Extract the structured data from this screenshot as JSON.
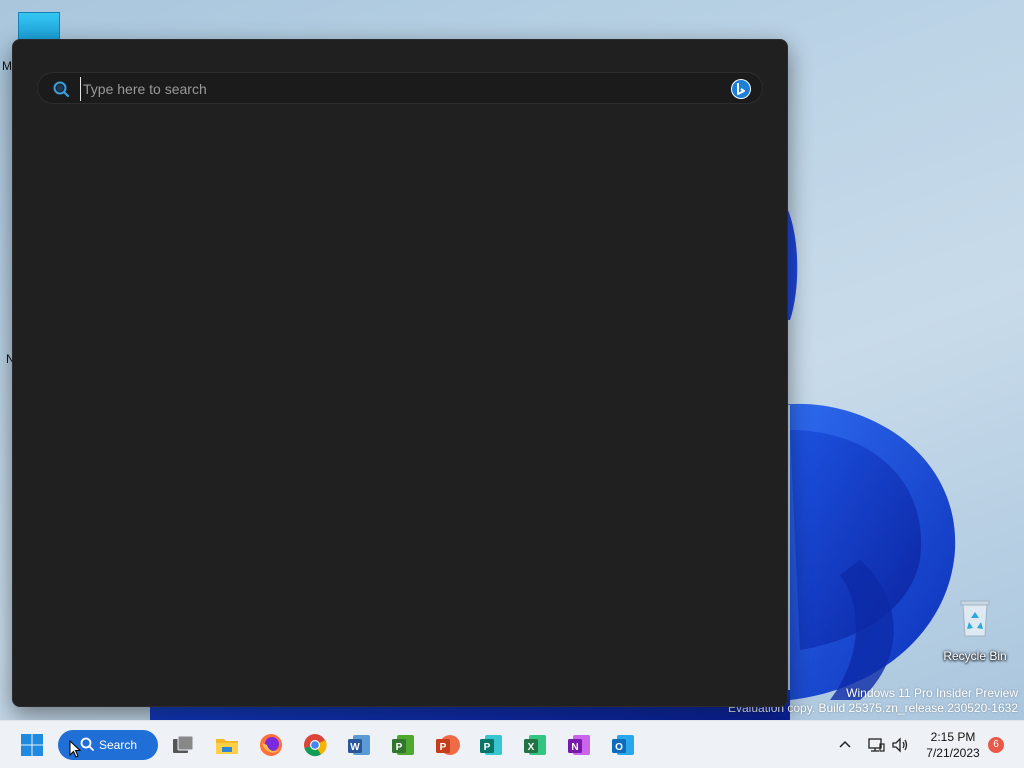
{
  "desktop": {
    "side_letters": [
      "M",
      "N"
    ],
    "recycle_bin_label": "Recycle Bin",
    "watermark_line1": "Windows 11 Pro Insider Preview",
    "watermark_line2": "Evaluation copy. Build 25375.zn_release.230520-1632"
  },
  "search_panel": {
    "placeholder": "Type here to search",
    "value": "",
    "left_icon": "search-icon",
    "right_icon": "bing-chat-icon"
  },
  "taskbar": {
    "start_icon": "windows-start-icon",
    "search_label": "Search",
    "apps": [
      {
        "name": "task-view-icon"
      },
      {
        "name": "file-explorer-icon"
      },
      {
        "name": "firefox-icon"
      },
      {
        "name": "chrome-icon"
      },
      {
        "name": "word-icon",
        "letter": "W",
        "color": "#2b579a"
      },
      {
        "name": "project-icon",
        "letter": "P",
        "color": "#31752f"
      },
      {
        "name": "powerpoint-icon",
        "letter": "P",
        "color": "#d24726"
      },
      {
        "name": "publisher-icon",
        "letter": "P",
        "color": "#077568"
      },
      {
        "name": "excel-icon",
        "letter": "X",
        "color": "#217346"
      },
      {
        "name": "onenote-icon",
        "letter": "N",
        "color": "#7719aa"
      },
      {
        "name": "outlook-icon",
        "letter": "O",
        "color": "#0f6cbd"
      }
    ],
    "tray": {
      "time": "2:15 PM",
      "date": "7/21/2023",
      "notification_count": "6"
    }
  },
  "colors": {
    "accent": "#1f6fd6",
    "panel_bg": "#202020",
    "taskbar_bg": "#eef1f6",
    "badge": "#e8594a"
  }
}
